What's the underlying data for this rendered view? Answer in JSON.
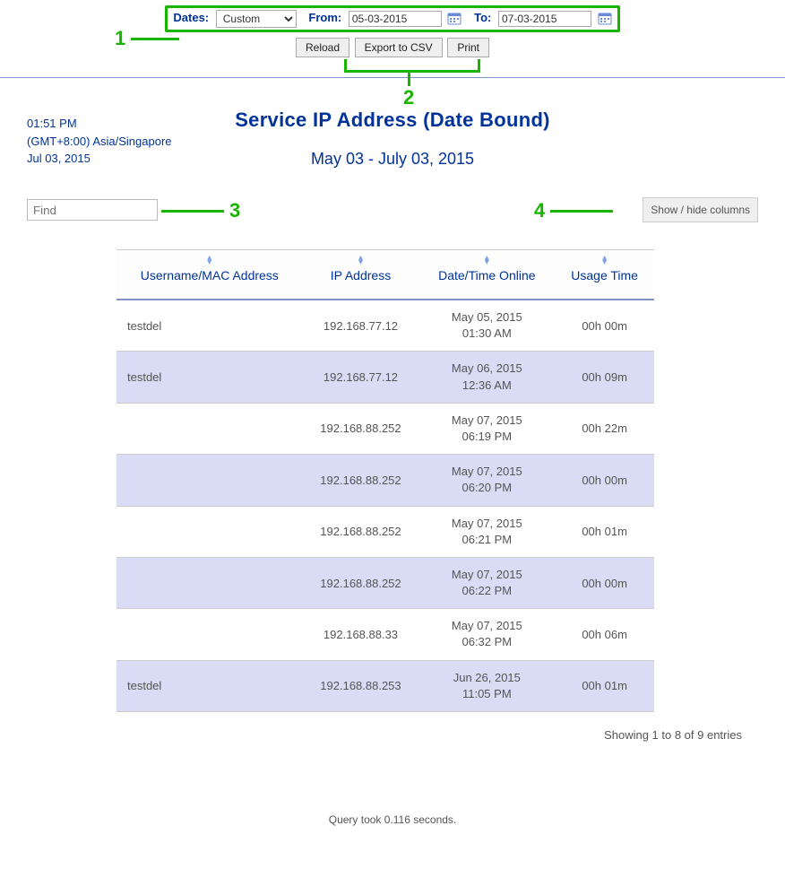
{
  "filters": {
    "dates_label": "Dates:",
    "dates_value": "Custom",
    "from_label": "From:",
    "from_value": "05-03-2015",
    "to_label": "To:",
    "to_value": "07-03-2015"
  },
  "buttons": {
    "reload": "Reload",
    "export_csv": "Export to CSV",
    "print": "Print",
    "show_hide": "Show / hide columns"
  },
  "meta": {
    "time": "01:51 PM",
    "tz": "(GMT+8:00) Asia/Singapore",
    "date": "Jul 03, 2015"
  },
  "title": "Service IP Address (Date Bound)",
  "subtitle": "May 03 - July 03, 2015",
  "search_placeholder": "Find",
  "columns": {
    "c0": "Username/MAC Address",
    "c1": "IP Address",
    "c2": "Date/Time Online",
    "c3": "Usage Time"
  },
  "rows": [
    {
      "user": "testdel",
      "ip": "192.168.77.12",
      "dt1": "May 05, 2015",
      "dt2": "01:30 AM",
      "usage": "00h 00m"
    },
    {
      "user": "testdel",
      "ip": "192.168.77.12",
      "dt1": "May 06, 2015",
      "dt2": "12:36 AM",
      "usage": "00h 09m"
    },
    {
      "user": "",
      "ip": "192.168.88.252",
      "dt1": "May 07, 2015",
      "dt2": "06:19 PM",
      "usage": "00h 22m"
    },
    {
      "user": "",
      "ip": "192.168.88.252",
      "dt1": "May 07, 2015",
      "dt2": "06:20 PM",
      "usage": "00h 00m"
    },
    {
      "user": "",
      "ip": "192.168.88.252",
      "dt1": "May 07, 2015",
      "dt2": "06:21 PM",
      "usage": "00h 01m"
    },
    {
      "user": "",
      "ip": "192.168.88.252",
      "dt1": "May 07, 2015",
      "dt2": "06:22 PM",
      "usage": "00h 00m"
    },
    {
      "user": "",
      "ip": "192.168.88.33",
      "dt1": "May 07, 2015",
      "dt2": "06:32 PM",
      "usage": "00h 06m"
    },
    {
      "user": "testdel",
      "ip": "192.168.88.253",
      "dt1": "Jun 26, 2015",
      "dt2": "11:05 PM",
      "usage": "00h 01m"
    }
  ],
  "showing": "Showing 1 to 8 of 9 entries",
  "query_time": "Query took 0.116 seconds.",
  "annotations": {
    "n1": "1",
    "n2": "2",
    "n3": "3",
    "n4": "4"
  }
}
